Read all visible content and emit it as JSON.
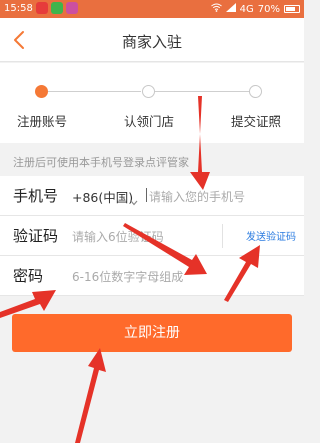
{
  "status_bar": {
    "time": "15:58",
    "network": "4G",
    "battery": "70%"
  },
  "nav": {
    "title": "商家入驻"
  },
  "steps": [
    {
      "label": "注册账号",
      "active": true
    },
    {
      "label": "认领门店",
      "active": false
    },
    {
      "label": "提交证照",
      "active": false
    }
  ],
  "hint": "注册后可使用本手机号登录点评管家",
  "form": {
    "phone": {
      "label": "手机号",
      "country_code": "+86(中国)",
      "placeholder": "请输入您的手机号"
    },
    "code": {
      "label": "验证码",
      "placeholder": "请输入6位验证码",
      "send_label": "发送验证码"
    },
    "password": {
      "label": "密码",
      "placeholder": "6-16位数字字母组成"
    }
  },
  "submit": {
    "label": "立即注册"
  },
  "colors": {
    "accent": "#ff6a2b",
    "link": "#2a7be0",
    "status_bar": "#e96f3f",
    "annotation_arrow": "#e53228"
  }
}
